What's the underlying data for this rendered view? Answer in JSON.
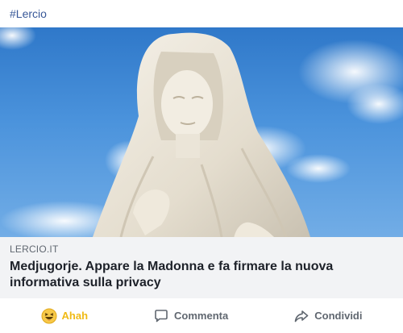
{
  "post": {
    "hashtag": "#Lercio"
  },
  "link": {
    "image_icon": "madonna-statue-sky",
    "domain": "LERCIO.IT",
    "title": "Medjugorje. Appare la Madonna e fa firmare la nuova informativa sulla privacy"
  },
  "actions": {
    "reaction_label": "Ahah",
    "reaction_icon": "haha-emoji-icon",
    "comment_label": "Commenta",
    "comment_icon": "comment-bubble-icon",
    "share_label": "Condividi",
    "share_icon": "share-arrow-icon"
  },
  "colors": {
    "link_blue": "#385898",
    "reaction_yellow": "#f0ba15",
    "muted_gray": "#606770",
    "card_bg": "#f2f3f5"
  }
}
